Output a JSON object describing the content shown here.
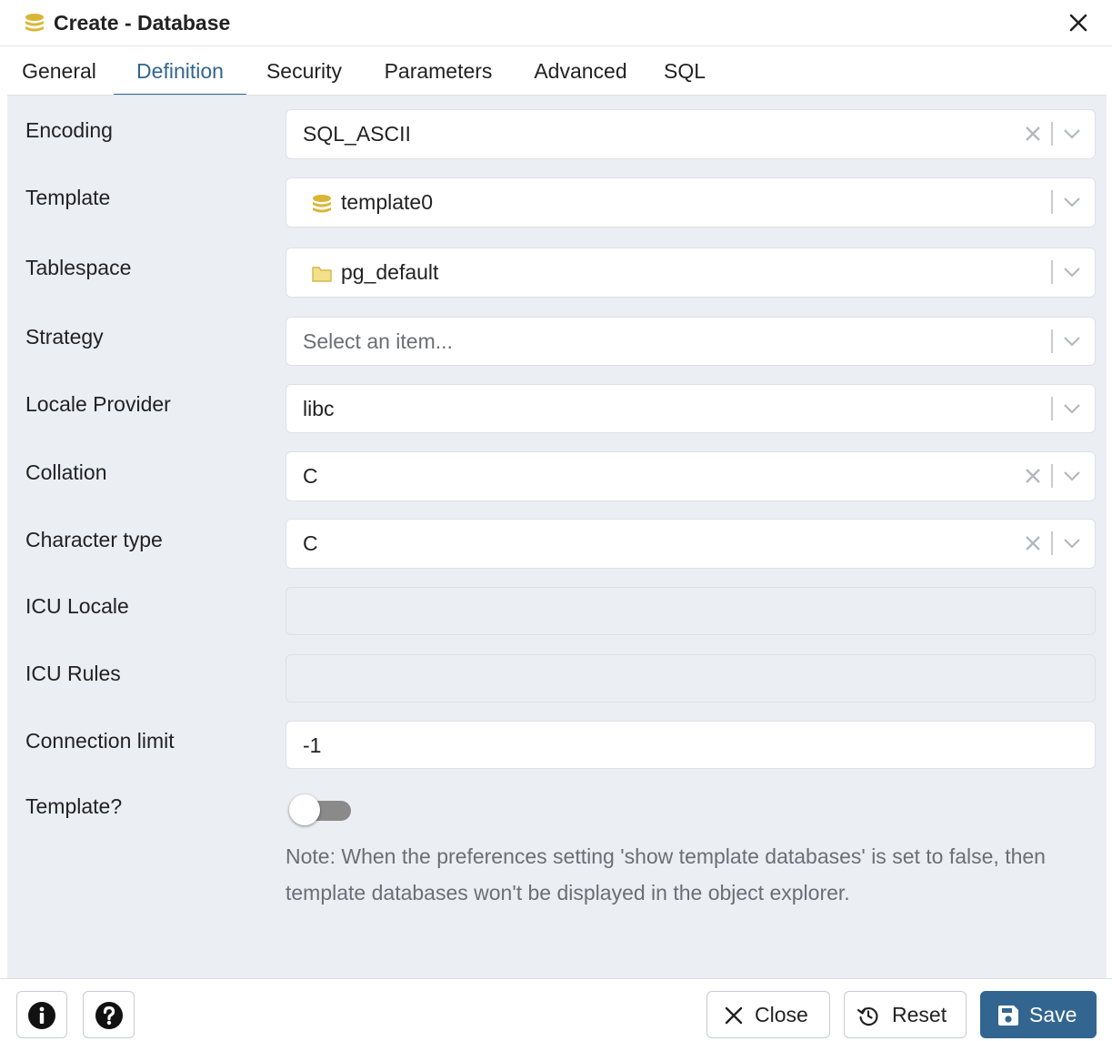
{
  "window": {
    "title": "Create - Database"
  },
  "tabs": [
    {
      "label": "General"
    },
    {
      "label": "Definition",
      "active": true
    },
    {
      "label": "Security"
    },
    {
      "label": "Parameters"
    },
    {
      "label": "Advanced"
    },
    {
      "label": "SQL"
    }
  ],
  "form": {
    "encoding": {
      "label": "Encoding",
      "value": "SQL_ASCII"
    },
    "template": {
      "label": "Template",
      "value": "template0",
      "icon": "database-icon"
    },
    "tablespace": {
      "label": "Tablespace",
      "value": "pg_default",
      "icon": "folder-icon"
    },
    "strategy": {
      "label": "Strategy",
      "placeholder": "Select an item..."
    },
    "locale_provider": {
      "label": "Locale Provider",
      "value": "libc"
    },
    "collation": {
      "label": "Collation",
      "value": "C"
    },
    "character_type": {
      "label": "Character type",
      "value": "C"
    },
    "icu_locale": {
      "label": "ICU Locale",
      "value": ""
    },
    "icu_rules": {
      "label": "ICU Rules",
      "value": ""
    },
    "connection_limit": {
      "label": "Connection limit",
      "value": "-1"
    },
    "is_template": {
      "label": "Template?",
      "checked": false
    },
    "note": "Note: When the preferences setting 'show template databases' is set to false, then template databases won't be displayed in the object explorer."
  },
  "footer": {
    "close_label": "Close",
    "reset_label": "Reset",
    "save_label": "Save"
  },
  "colors": {
    "accent": "#326690",
    "background": "#ebeef3",
    "database_icon": "#d9b634",
    "folder_icon": "#f3e08a"
  }
}
